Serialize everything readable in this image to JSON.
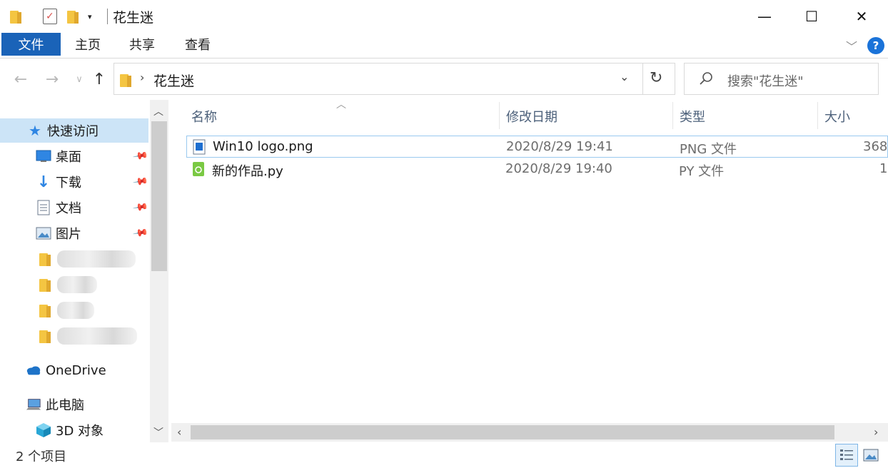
{
  "window": {
    "title": "花生迷"
  },
  "title_controls": {
    "minimize": "—",
    "maximize": "☐",
    "close": "✕"
  },
  "ribbon": {
    "tabs": [
      "文件",
      "主页",
      "共享",
      "查看"
    ],
    "expand_icon": "chevron-down-icon",
    "help": "?"
  },
  "address": {
    "crumb": "花生迷",
    "search_placeholder": "搜索\"花生迷\""
  },
  "nav": {
    "quick_access": "快速访问",
    "pinned": [
      "桌面",
      "下载",
      "文档",
      "图片"
    ],
    "onedrive": "OneDrive",
    "this_pc": "此电脑",
    "objects3d": "3D 对象"
  },
  "columns": {
    "name": "名称",
    "modified": "修改日期",
    "type": "类型",
    "size": "大小"
  },
  "files": [
    {
      "name": "Win10 logo.png",
      "modified": "2020/8/29 19:41",
      "type": "PNG 文件",
      "size": "368",
      "icon": "png-image-icon"
    },
    {
      "name": "新的作品.py",
      "modified": "2020/8/29 19:40",
      "type": "PY 文件",
      "size": "1",
      "icon": "python-file-icon"
    }
  ],
  "status": {
    "count": "2 个项目"
  },
  "colors": {
    "accent": "#1a63b8",
    "selected": "#cce4f7",
    "header_text": "#4c607a"
  }
}
